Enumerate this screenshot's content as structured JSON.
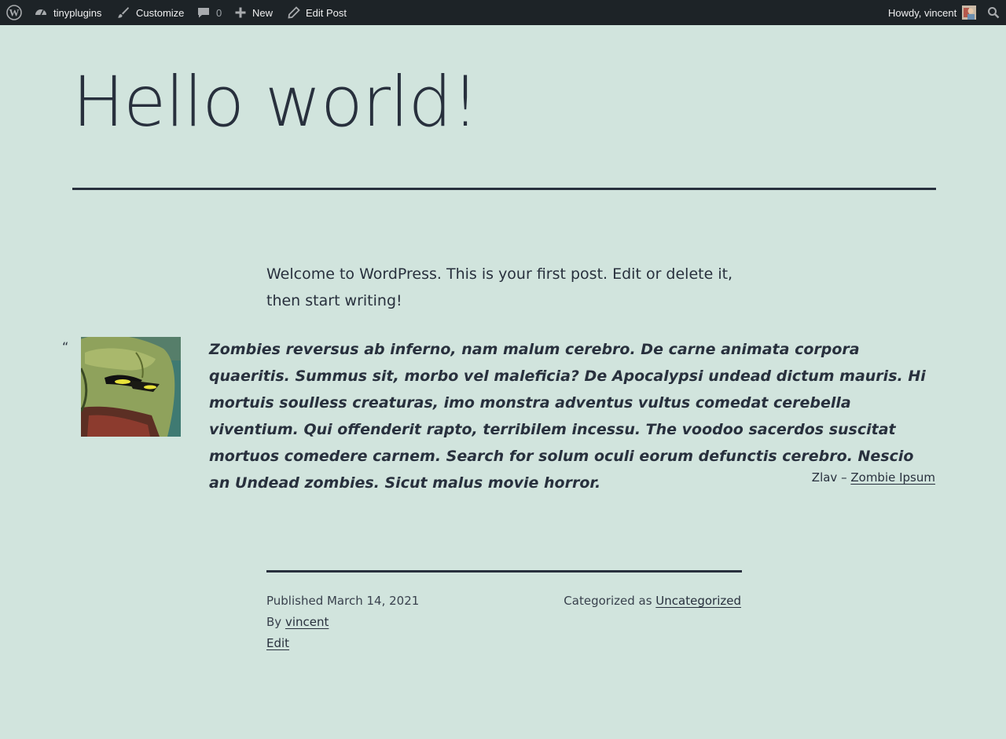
{
  "adminbar": {
    "site_name": "tinyplugins",
    "customize": "Customize",
    "comments_count": "0",
    "new": "New",
    "edit_post": "Edit Post",
    "howdy": "Howdy, vincent"
  },
  "post": {
    "title": "Hello world!",
    "intro": "Welcome to WordPress. This is your first post. Edit or delete it, then start writing!",
    "quote_mark": "“",
    "quote": "Zombies reversus ab inferno, nam malum cerebro. De carne animata corpora quaeritis. Summus sit, morbo vel maleficia? De Apocalypsi undead dictum mauris. Hi mortuis soulless creaturas, imo monstra adventus vultus comedat cerebella viventium. Qui offenderit rapto, terribilem incessu. The voodoo sacerdos suscitat mortuos comedere carnem. Search for solum oculi eorum defunctis cerebro. Nescio an Undead zombies. Sicut malus movie horror.",
    "cite_author": "Zlav –",
    "cite_link": "Zombie Ipsum"
  },
  "footer": {
    "published": "Published March 14, 2021",
    "by_label": "By",
    "author": "vincent",
    "edit": "Edit",
    "categorized_label": "Categorized as",
    "category": "Uncategorized"
  },
  "colors": {
    "background": "#d1e4dd",
    "text": "#28303d",
    "adminbar": "#1d2327"
  }
}
